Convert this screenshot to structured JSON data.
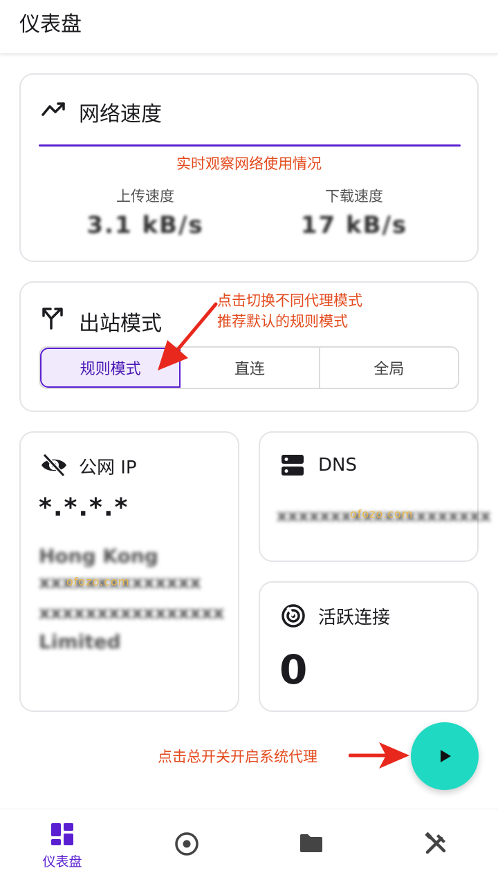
{
  "header": {
    "title": "仪表盘"
  },
  "speed_card": {
    "title": "网络速度",
    "annotation": "实时观察网络使用情况",
    "upload_label": "上传速度",
    "upload_value": "3.1 kB/s",
    "download_label": "下载速度",
    "download_value": "17 kB/s"
  },
  "mode_card": {
    "title": "出站模式",
    "annotation_line1": "点击切换不同代理模式",
    "annotation_line2": "推荐默认的规则模式",
    "options": [
      {
        "label": "规则模式",
        "active": true
      },
      {
        "label": "直连",
        "active": false
      },
      {
        "label": "全局",
        "active": false
      }
    ]
  },
  "ip_card": {
    "title": "公网 IP",
    "ip": "*.*.*.*",
    "location_lines": [
      "Hong Kong",
      "xxxxxxxxxxxxxx",
      "xxxxxxxxxxxxxxxx",
      "Limited"
    ],
    "watermark": "ofozo.com"
  },
  "dns_card": {
    "title": "DNS",
    "value": "xxxxxxxxxxxxxxxxxxxx",
    "watermark": "ofozo.com"
  },
  "connections_card": {
    "title": "活跃连接",
    "count": "0"
  },
  "fab_annotation": "点击总开关开启系统代理",
  "bottom_nav": {
    "items": [
      {
        "label": "仪表盘",
        "icon": "dashboard-icon",
        "active": true
      },
      {
        "label": "",
        "icon": "target-icon",
        "active": false
      },
      {
        "label": "",
        "icon": "folder-icon",
        "active": false
      },
      {
        "label": "",
        "icon": "tools-icon",
        "active": false
      }
    ]
  },
  "colors": {
    "accent": "#5a1fd1",
    "fab": "#1fd9c3",
    "annotation": "#e34a1c"
  }
}
